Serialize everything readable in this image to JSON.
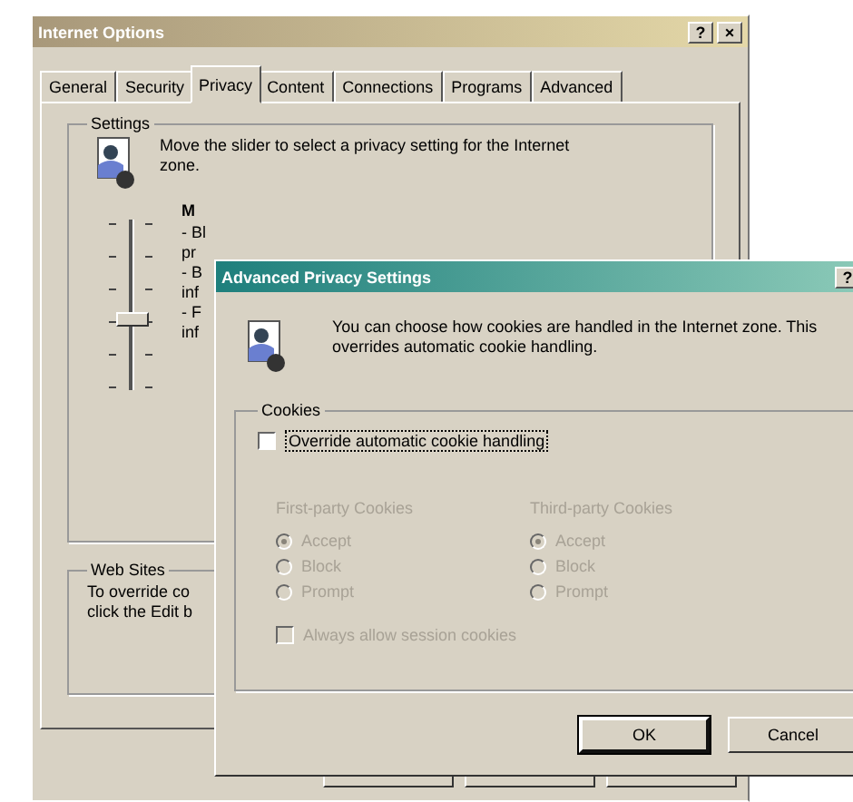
{
  "window": {
    "title": "Internet Options",
    "title_buttons": [
      "?",
      "×"
    ]
  },
  "tabs": [
    {
      "label": "General",
      "selected": false
    },
    {
      "label": "Security",
      "selected": false
    },
    {
      "label": "Privacy",
      "selected": true
    },
    {
      "label": "Content",
      "selected": false
    },
    {
      "label": "Connections",
      "selected": false
    },
    {
      "label": "Programs",
      "selected": false
    },
    {
      "label": "Advanced",
      "selected": false
    }
  ],
  "settings": {
    "title": "Settings",
    "description": "Move the slider to select a privacy setting for the Internet zone.",
    "slider": {
      "level": 0.4
    },
    "level_title": "M",
    "level_lines": [
      "- Bl",
      "pr",
      "- B",
      "inf",
      "- F",
      "inf"
    ]
  },
  "web_sites": {
    "title": "Web Sites",
    "lines": [
      "To override co",
      "click the Edit b"
    ]
  },
  "bottom_buttons": [
    {
      "kind": "hidden"
    },
    {
      "kind": "hidden"
    },
    {
      "kind": "hidden"
    }
  ],
  "dialog": {
    "title": "Advanced Privacy Settings",
    "title_buttons": [
      "?"
    ],
    "description": "You can choose how cookies are handled in the Internet zone.  This overrides automatic cookie handling.",
    "cookies": {
      "title": "Cookies",
      "override": {
        "label": "Override automatic cookie handling",
        "checked": false
      },
      "columns": [
        {
          "heading": "First-party Cookies",
          "disabled": true,
          "options": [
            {
              "label": "Accept",
              "selected": true
            },
            {
              "label": "Block",
              "selected": false
            },
            {
              "label": "Prompt",
              "selected": false
            }
          ]
        },
        {
          "heading": "Third-party Cookies",
          "disabled": true,
          "options": [
            {
              "label": "Accept",
              "selected": true
            },
            {
              "label": "Block",
              "selected": false
            },
            {
              "label": "Prompt",
              "selected": false
            }
          ]
        }
      ],
      "session": {
        "label": "Always allow session cookies",
        "checked": false,
        "disabled": true
      }
    },
    "buttons": [
      "OK",
      "Cancel"
    ]
  }
}
